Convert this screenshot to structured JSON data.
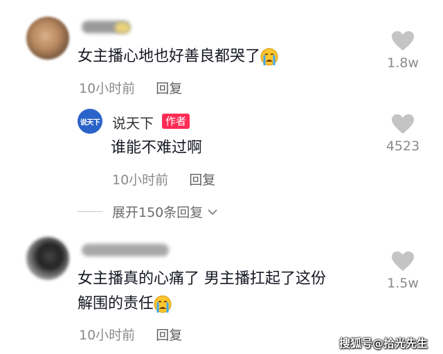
{
  "comments": [
    {
      "text": "女主播心地也好善良都哭了",
      "emoji": "crying-face",
      "time": "10小时前",
      "reply_label": "回复",
      "likes": "1.8w"
    },
    {
      "author": "说天下",
      "badge": "作者",
      "avatar_text": "说天下",
      "text": "谁能不难过啊",
      "time": "10小时前",
      "reply_label": "回复",
      "likes": "4523"
    },
    {
      "text_line1": "女主播真的心痛了 男主播扛起了这份",
      "text_line2": "解围的责任",
      "emoji": "crying-face",
      "time": "10小时前",
      "reply_label": "回复",
      "likes": "1.5w"
    }
  ],
  "expand_replies": "展开150条回复",
  "watermark": "搜狐号@拾光先生",
  "colors": {
    "accent": "#fe2c55",
    "text": "#161823",
    "meta": "#8a8a8a",
    "heart": "#c4c4c4"
  }
}
